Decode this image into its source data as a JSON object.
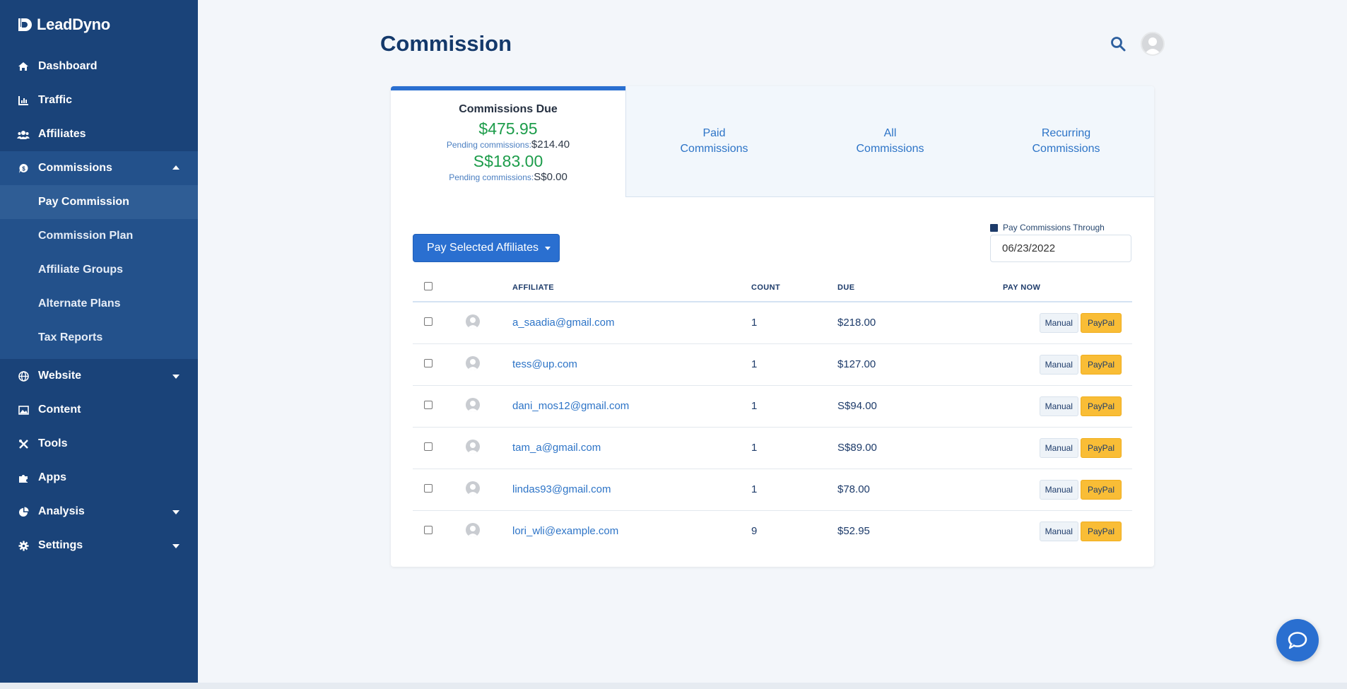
{
  "brand": {
    "name": "LeadDyno"
  },
  "sidebar": {
    "items": [
      {
        "label": "Dashboard",
        "icon": "home-icon"
      },
      {
        "label": "Traffic",
        "icon": "chart-icon"
      },
      {
        "label": "Affiliates",
        "icon": "users-icon"
      },
      {
        "label": "Commissions",
        "icon": "commission-icon",
        "expanded": true
      },
      {
        "label": "Website",
        "icon": "globe-icon"
      },
      {
        "label": "Content",
        "icon": "image-icon"
      },
      {
        "label": "Tools",
        "icon": "tools-icon"
      },
      {
        "label": "Apps",
        "icon": "puzzle-icon"
      },
      {
        "label": "Analysis",
        "icon": "pie-icon"
      },
      {
        "label": "Settings",
        "icon": "gear-icon"
      }
    ],
    "commission_sub": [
      {
        "label": "Pay Commission",
        "active": true
      },
      {
        "label": "Commission Plan"
      },
      {
        "label": "Affiliate Groups"
      },
      {
        "label": "Alternate Plans"
      },
      {
        "label": "Tax Reports"
      }
    ]
  },
  "header": {
    "title": "Commission"
  },
  "tabs": {
    "due": {
      "label": "Commissions Due",
      "amount_usd": "$475.95",
      "pending_label": "Pending commissions:",
      "pending_usd": "$214.40",
      "amount_sgd": "S$183.00",
      "pending_sgd": "S$0.00"
    },
    "paid": {
      "line1": "Paid",
      "line2": "Commissions"
    },
    "all": {
      "line1": "All",
      "line2": "Commissions"
    },
    "recurring": {
      "line1": "Recurring",
      "line2": "Commissions"
    }
  },
  "toolbar": {
    "pay_selected_label": "Pay Selected Affiliates",
    "through_label": "Pay Commissions Through",
    "through_date": "06/23/2022"
  },
  "table": {
    "headers": {
      "affiliate": "AFFILIATE",
      "count": "COUNT",
      "due": "DUE",
      "pay_now": "PAY NOW"
    },
    "manual_label": "Manual",
    "paypal_label": "PayPal",
    "rows": [
      {
        "email": "a_saadia@gmail.com",
        "count": "1",
        "due": "$218.00"
      },
      {
        "email": "tess@up.com",
        "count": "1",
        "due": "$127.00"
      },
      {
        "email": "dani_mos12@gmail.com",
        "count": "1",
        "due": "S$94.00"
      },
      {
        "email": "tam_a@gmail.com",
        "count": "1",
        "due": "S$89.00"
      },
      {
        "email": "lindas93@gmail.com",
        "count": "1",
        "due": "$78.00"
      },
      {
        "email": "lori_wli@example.com",
        "count": "9",
        "due": "$52.95"
      }
    ]
  },
  "colors": {
    "sidebar": "#1a4379",
    "accent": "#2a6fd0",
    "green": "#1c9c4a",
    "paypal": "#f9bd36"
  }
}
